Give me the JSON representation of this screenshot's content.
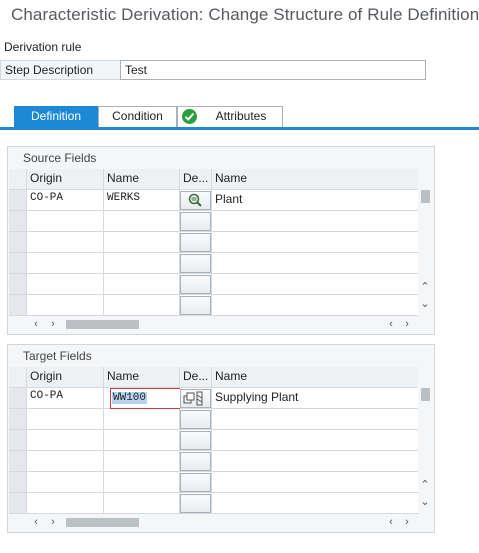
{
  "header": {
    "title": "Characteristic Derivation: Change Structure of Rule Definition"
  },
  "form": {
    "derivation_rule_label": "Derivation rule",
    "step_description_label": "Step Description",
    "step_description_value": "Test"
  },
  "tabs": [
    {
      "label": "Definition",
      "active": true
    },
    {
      "label": "Condition",
      "active": false
    },
    {
      "label": "Attributes",
      "active": false,
      "icon": "check-circle-icon"
    }
  ],
  "source": {
    "title": "Source Fields",
    "columns": [
      "Origin",
      "Name",
      "De...",
      "Name"
    ],
    "rows": [
      {
        "origin": "CO-PA",
        "name": "WERKS",
        "description": "Plant",
        "icon": "search-detail-icon"
      }
    ]
  },
  "target": {
    "title": "Target Fields",
    "columns": [
      "Origin",
      "Name",
      "De...",
      "Name"
    ],
    "rows": [
      {
        "origin": "CO-PA",
        "name": "WW100",
        "description": "Supplying Plant",
        "icon": "copy-pattern-icon"
      }
    ]
  },
  "colors": {
    "accent": "#1d89d6",
    "check": "#2a9d3c",
    "edit_border": "#cf3d3d"
  }
}
